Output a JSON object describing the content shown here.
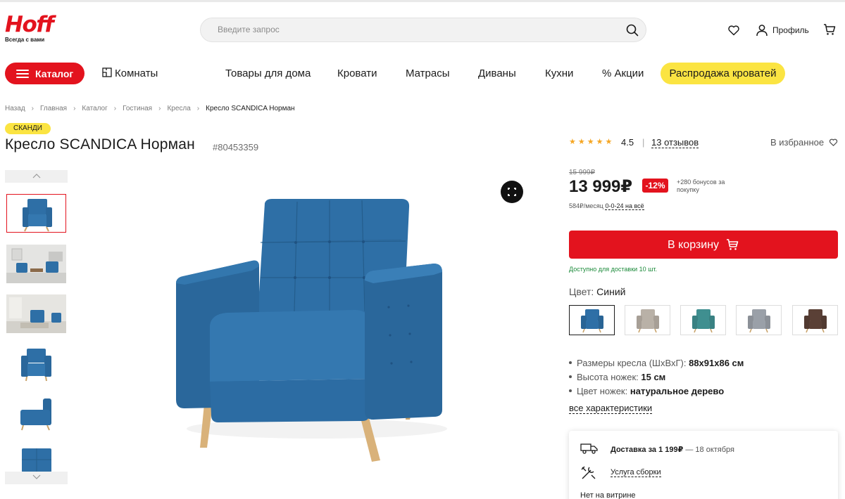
{
  "brand": {
    "logo_text": "Hoff",
    "tagline": "Всегда с вами",
    "red": "#e3131e",
    "yellow": "#fbe442"
  },
  "header": {
    "search_placeholder": "Введите запрос",
    "icons": [
      "search-icon",
      "heart-icon",
      "user-icon",
      "cart-icon"
    ],
    "profile_label": "Профиль"
  },
  "nav": {
    "catalog_label": "Каталог",
    "rooms_label": "Комнаты",
    "items": [
      "Товары для дома",
      "Кровати",
      "Матрасы",
      "Диваны",
      "Кухни",
      "% Акции"
    ],
    "promo_label": "Распродажа кроватей"
  },
  "breadcrumb": [
    "Назад",
    "Главная",
    "Каталог",
    "Гостиная",
    "Кресла",
    "Кресло SCANDICA Норман"
  ],
  "product": {
    "style_badge": "СКАНДИ",
    "title": "Кресло SCANDICA Норман",
    "sku": "#80453359",
    "rating": "4.5",
    "rating_stars": "★★★★★",
    "reviews_label": "13 отзывов",
    "favorite_label": "В избранное",
    "old_price": "15 999₽",
    "price": "13 999₽",
    "discount": "-12%",
    "bonus": "+280 бонусов за покупку",
    "monthly_price": "584₽/месяц",
    "credit_terms": "0-0-24 на всё",
    "cart_label": "В корзину",
    "availability": "Доступно для доставки 10 шт.",
    "color_label": "Цвет:",
    "color_value": "Синий",
    "swatches": [
      {
        "name": "Синий",
        "color": "#2e6fa6"
      },
      {
        "name": "Бежевый",
        "color": "#b9b1a7"
      },
      {
        "name": "Бирюзовый",
        "color": "#3f8f90"
      },
      {
        "name": "Серый",
        "color": "#9aa0a8"
      },
      {
        "name": "Коричневый",
        "color": "#5a4036"
      }
    ],
    "specs": [
      {
        "label": "Размеры кресла (ШхВхГ):",
        "value": "88x91x86 см"
      },
      {
        "label": "Высота ножек:",
        "value": "15 см"
      },
      {
        "label": "Цвет ножек:",
        "value": "натуральное дерево"
      }
    ],
    "all_specs_label": "все характеристики",
    "upholstery_color": "#2e6fa6"
  },
  "delivery": {
    "delivery_title": "Доставка за 1 199₽",
    "delivery_date": "— 18 октября",
    "assembly_label": "Услуга сборки",
    "showcase_label": "Нет на витрине"
  }
}
